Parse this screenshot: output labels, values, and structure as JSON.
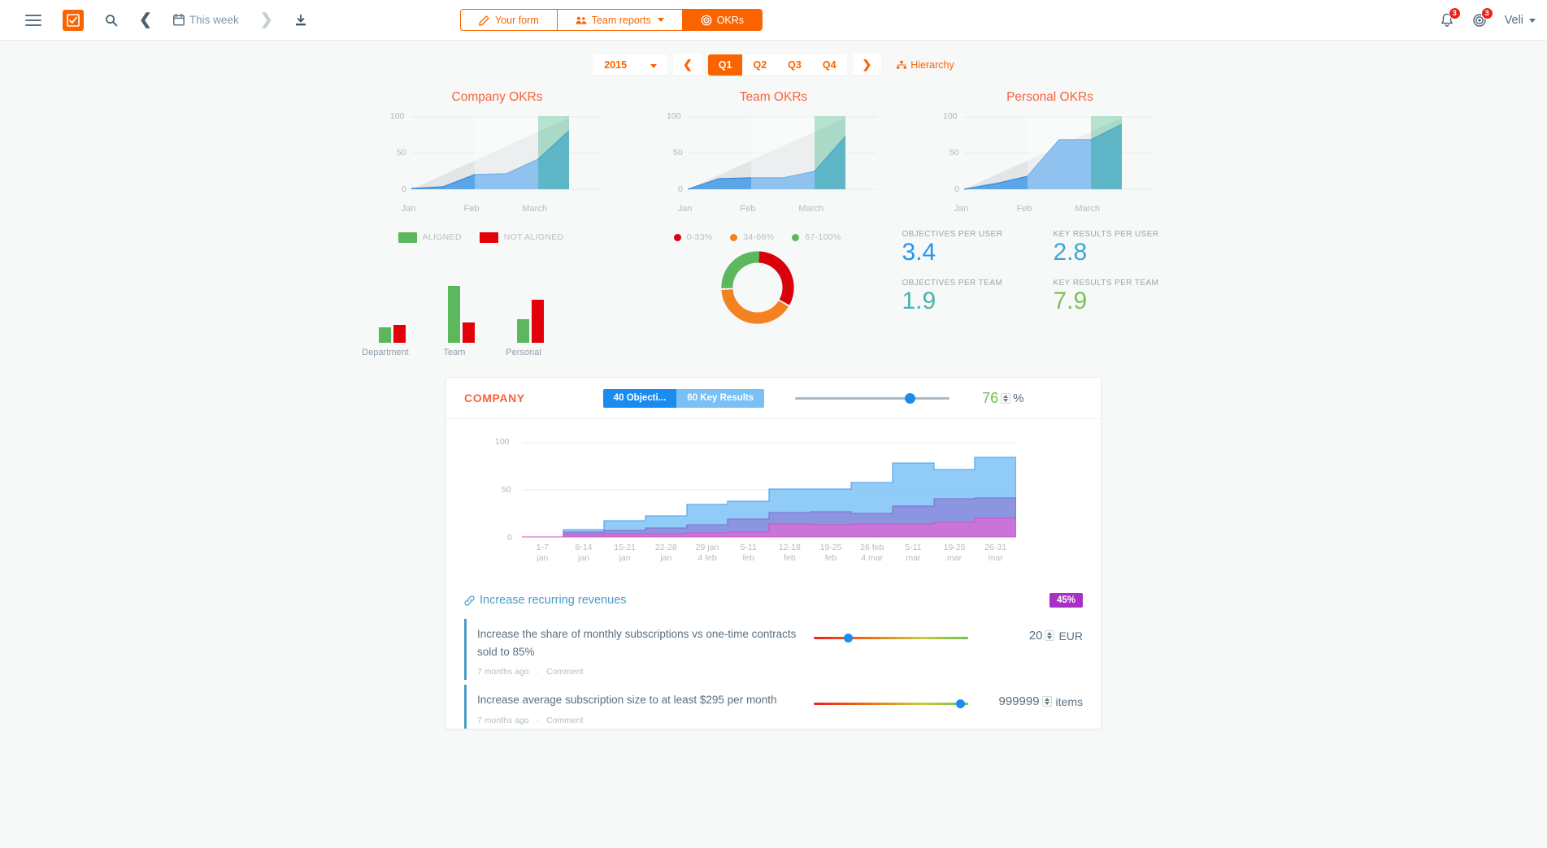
{
  "topbar": {
    "menu_icon": "hamburger-icon",
    "logo_icon": "checkbox-logo-icon",
    "search_icon": "search-icon",
    "prev_icon": "chevron-left-icon",
    "calendar_icon": "calendar-icon",
    "period_label": "This week",
    "next_icon": "chevron-right-icon",
    "download_icon": "download-icon",
    "tabs": [
      {
        "label": "Your form",
        "icon": "edit-icon",
        "active": false,
        "caret": false
      },
      {
        "label": "Team reports",
        "icon": "users-icon",
        "active": false,
        "caret": true
      },
      {
        "label": "OKRs",
        "icon": "target-icon",
        "active": true,
        "caret": false
      }
    ],
    "notifications_icon": "bell-icon",
    "notifications_count": "3",
    "objectives_icon": "target-icon",
    "objectives_count": "3",
    "user_name": "Veli"
  },
  "quarterbar": {
    "year": "2015",
    "year_caret_icon": "chevron-down-icon",
    "prev_icon": "chevron-left-icon",
    "next_icon": "chevron-right-icon",
    "quarters": [
      "Q1",
      "Q2",
      "Q3",
      "Q4"
    ],
    "selected_quarter": "Q1",
    "hierarchy_label": "Hierarchy",
    "hierarchy_icon": "hierarchy-icon"
  },
  "chart_data": [
    {
      "type": "area",
      "title": "Company OKRs",
      "xlabel": "",
      "ylabel": "",
      "ylim": [
        0,
        100
      ],
      "yticks": [
        0,
        50,
        100
      ],
      "categories": [
        "Jan",
        "Feb",
        "March"
      ],
      "x": [
        0,
        1,
        2,
        3,
        4,
        5,
        6
      ],
      "series": [
        {
          "name": "progress",
          "values": [
            1,
            3,
            20,
            21,
            21,
            41,
            80
          ]
        },
        {
          "name": "target",
          "values": [
            0,
            17,
            33,
            50,
            67,
            83,
            100
          ]
        }
      ],
      "grid": true,
      "legend": "none"
    },
    {
      "type": "area",
      "title": "Team OKRs",
      "xlabel": "",
      "ylabel": "",
      "ylim": [
        0,
        100
      ],
      "yticks": [
        0,
        50,
        100
      ],
      "categories": [
        "Jan",
        "Feb",
        "March"
      ],
      "x": [
        0,
        1,
        2,
        3,
        4,
        5,
        6
      ],
      "series": [
        {
          "name": "progress",
          "values": [
            0,
            14,
            15,
            15,
            16,
            25,
            72
          ]
        },
        {
          "name": "target",
          "values": [
            0,
            17,
            33,
            50,
            67,
            83,
            100
          ]
        }
      ],
      "grid": true,
      "legend": "none"
    },
    {
      "type": "area",
      "title": "Personal OKRs",
      "xlabel": "",
      "ylabel": "",
      "ylim": [
        0,
        100
      ],
      "yticks": [
        0,
        50,
        100
      ],
      "categories": [
        "Jan",
        "Feb",
        "March"
      ],
      "x": [
        0,
        1,
        2,
        3,
        4,
        5,
        6
      ],
      "series": [
        {
          "name": "progress",
          "values": [
            0,
            8,
            18,
            68,
            68,
            69,
            88
          ]
        },
        {
          "name": "target",
          "values": [
            0,
            17,
            33,
            50,
            67,
            83,
            100
          ]
        }
      ],
      "grid": true,
      "legend": "none"
    },
    {
      "type": "bar",
      "title": "",
      "categories": [
        "Department",
        "Team",
        "Personal"
      ],
      "series": [
        {
          "name": "ALIGNED",
          "values": [
            19,
            70,
            29
          ],
          "color": "#5cb85c"
        },
        {
          "name": "NOT ALIGNED",
          "values": [
            22,
            25,
            53
          ],
          "color": "#e3000b"
        }
      ],
      "ylim": [
        0,
        100
      ],
      "grid": false,
      "legend": "top"
    },
    {
      "type": "pie",
      "title": "",
      "subtype": "donut",
      "labels": [
        "0-33%",
        "34-66%",
        "67-100%"
      ],
      "values": [
        33,
        40,
        27
      ],
      "colors": [
        "#d9000c",
        "#f58220",
        "#5cb85c"
      ],
      "legend": "top"
    },
    {
      "type": "area",
      "subtype": "stacked-step",
      "title": "COMPANY",
      "ylim": [
        0,
        100
      ],
      "yticks": [
        0,
        50,
        100
      ],
      "categories": [
        "1-7 jan",
        "8-14 jan",
        "15-21 jan",
        "22-28 jan",
        "29 jan 4 feb",
        "5-11 feb",
        "12-18 feb",
        "19-25 feb",
        "26 feb 4 mar",
        "5-11 mar",
        "19-25 mar",
        "26-31 mar"
      ],
      "series": [
        {
          "name": "layer-pink",
          "values": [
            0,
            2,
            3,
            3,
            4,
            5,
            6,
            14,
            13,
            13,
            15,
            20
          ],
          "color": "#d96ad6"
        },
        {
          "name": "layer-purple",
          "values": [
            0,
            5,
            7,
            9,
            13,
            19,
            26,
            27,
            25,
            33,
            40,
            41
          ],
          "color": "#8a7fd6"
        },
        {
          "name": "layer-blue",
          "values": [
            0,
            8,
            17,
            22,
            34,
            38,
            51,
            51,
            58,
            78,
            71,
            84
          ],
          "color": "#79c0f7"
        }
      ],
      "grid": true,
      "legend": "none"
    }
  ],
  "mid_widgets": {
    "bar_legend": [
      {
        "label": "ALIGNED",
        "color": "#5cb85c"
      },
      {
        "label": "NOT ALIGNED",
        "color": "#e3000b"
      }
    ],
    "donut_legend": [
      {
        "label": "0-33%",
        "color": "#d9000c"
      },
      {
        "label": "34-66%",
        "color": "#f58220"
      },
      {
        "label": "67-100%",
        "color": "#5cb85c"
      }
    ],
    "stats": [
      {
        "label": "OBJECTIVES PER USER",
        "value": "3.4",
        "color": "#2196f3"
      },
      {
        "label": "KEY RESULTS PER USER",
        "value": "2.8",
        "color": "#3ba7d8"
      },
      {
        "label": "OBJECTIVES PER TEAM",
        "value": "1.9",
        "color": "#43b5b0"
      },
      {
        "label": "KEY RESULTS PER TEAM",
        "value": "7.9",
        "color": "#7bc258"
      }
    ]
  },
  "company_card": {
    "title": "COMPANY",
    "toggle_objectives": "40 Objecti...",
    "toggle_key_results": "60 Key Results",
    "slider_value": 76,
    "percent_value": "76",
    "percent_sign": "%",
    "spinner_up_icon": "caret-up-icon",
    "spinner_down_icon": "caret-down-icon",
    "y_labels": [
      "100",
      "50",
      "0"
    ],
    "x_labels": [
      {
        "top": "1-7",
        "bottom": "jan"
      },
      {
        "top": "8-14",
        "bottom": "jan"
      },
      {
        "top": "15-21",
        "bottom": "jan"
      },
      {
        "top": "22-28",
        "bottom": "jan"
      },
      {
        "top": "29 jan",
        "bottom": "4 feb"
      },
      {
        "top": "5-11",
        "bottom": "feb"
      },
      {
        "top": "12-18",
        "bottom": "feb"
      },
      {
        "top": "19-25",
        "bottom": "feb"
      },
      {
        "top": "26 feb",
        "bottom": "4 mar"
      },
      {
        "top": "5-11",
        "bottom": "mar"
      },
      {
        "top": "19-25",
        "bottom": "mar"
      },
      {
        "top": "26-31",
        "bottom": "mar"
      }
    ]
  },
  "objective": {
    "link_icon": "link-icon",
    "title": "Increase recurring revenues",
    "badge": "45%",
    "key_results": [
      {
        "text": "Increase the share of monthly subscriptions vs one-time contracts sold to 85%",
        "time": "7 months ago",
        "separator": "·",
        "comment": "Comment",
        "slider_pos": 21,
        "value": "20",
        "unit": "EUR"
      },
      {
        "text": "Increase average subscription size to at least $295 per month",
        "time": "7 months ago",
        "separator": "·",
        "comment": "Comment",
        "slider_pos": 99,
        "value": "999999",
        "unit": "items"
      }
    ]
  }
}
